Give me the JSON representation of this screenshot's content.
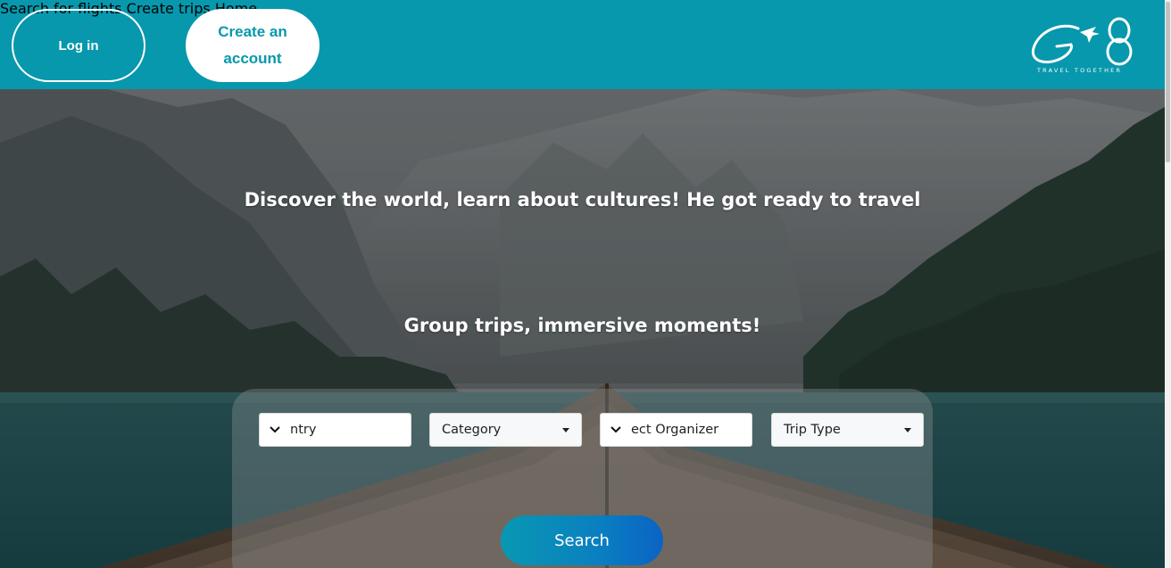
{
  "header": {
    "login_label": "Log in",
    "create_account_label": "Create an account",
    "nav": [
      {
        "label": "Search for flights"
      },
      {
        "label": "Create trips"
      },
      {
        "label": "Home"
      }
    ],
    "logo_tagline": "TRAVEL TOGETHER",
    "brand_color": "#0798ad"
  },
  "hero": {
    "headline": "Discover the world, learn about cultures! He got ready to travel",
    "subheadline": "Group trips, immersive moments!"
  },
  "search": {
    "country_value": "ntry",
    "category_value": "Category",
    "organizer_value": "ect Organizer",
    "trip_type_value": "Trip Type",
    "search_label": "Search"
  },
  "icons": {
    "chevron": "chevron-down-icon",
    "caret": "caret-down-icon",
    "logo": "g8-plane-logo"
  }
}
